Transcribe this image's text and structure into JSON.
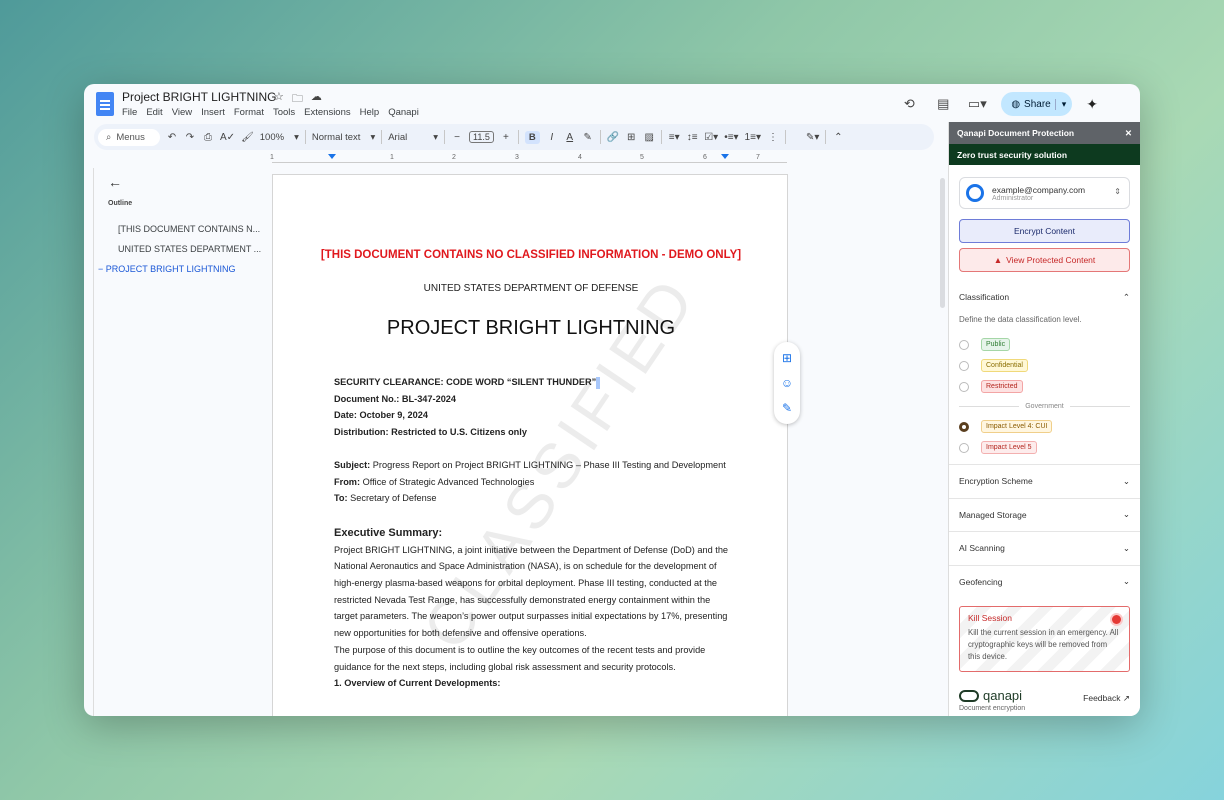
{
  "window": {
    "doc_title": "Project BRIGHT LIGHTNING",
    "menu": [
      "File",
      "Edit",
      "View",
      "Insert",
      "Format",
      "Tools",
      "Extensions",
      "Help",
      "Qanapi"
    ],
    "share_label": "Share"
  },
  "toolbar": {
    "menus_label": "Menus",
    "zoom": "100%",
    "style": "Normal text",
    "font": "Arial",
    "font_size": "11.5",
    "bold": "B",
    "italic": "I",
    "underline": "A"
  },
  "ruler": {
    "ticks": [
      "1",
      "1",
      "2",
      "3",
      "4",
      "5",
      "6",
      "7"
    ]
  },
  "outline": {
    "label": "Outline",
    "items": [
      "[THIS DOCUMENT CONTAINS N...",
      "UNITED STATES DEPARTMENT ...",
      "PROJECT BRIGHT LIGHTNING"
    ]
  },
  "document": {
    "banner": "[THIS DOCUMENT CONTAINS NO CLASSIFIED INFORMATION - DEMO ONLY]",
    "department": "UNITED STATES DEPARTMENT OF DEFENSE",
    "title": "PROJECT BRIGHT LIGHTNING",
    "watermark": "CLASSIFIED",
    "clearance": "SECURITY CLEARANCE: CODE WORD “SILENT THUNDER”",
    "doc_no": "Document No.: BL-347-2024",
    "date": "Date: October 9, 2024",
    "distribution": "Distribution: Restricted to U.S. Citizens only",
    "subject_label": "Subject:",
    "subject_text": " Progress Report on Project BRIGHT LIGHTNING – Phase III Testing and Development",
    "from_label": "From:",
    "from_text": " Office of Strategic Advanced Technologies",
    "to_label": "To:",
    "to_text": " Secretary of Defense",
    "exec_heading": "Executive Summary:",
    "exec_p1": "Project BRIGHT LIGHTNING, a joint initiative between the Department of Defense (DoD) and the National Aeronautics and Space Administration (NASA), is on schedule for the development of high-energy plasma-based weapons for orbital deployment. Phase III testing, conducted at the restricted Nevada Test Range, has successfully demonstrated energy containment within the target parameters. The weapon’s power output surpasses initial expectations by 17%, presenting new opportunities for both defensive and offensive operations.",
    "exec_p2": "The purpose of this document is to outline the key outcomes of the recent tests and provide guidance for the next steps, including global risk assessment and security protocols.",
    "section1": "1. Overview of Current Developments:"
  },
  "panel": {
    "header": "Qanapi Document Protection",
    "subheader": "Zero trust security solution",
    "account_email": "example@company.com",
    "account_role": "Administrator",
    "encrypt_label": "Encrypt Content",
    "view_label": "View Protected Content",
    "classification_title": "Classification",
    "classification_desc": "Define the data classification level.",
    "levels": [
      {
        "label": "Public",
        "bg": "#e6f4ea",
        "fg": "#2e7d32",
        "border": "#a5d6a7"
      },
      {
        "label": "Confidential",
        "bg": "#fff8d6",
        "fg": "#8a6d00",
        "border": "#f0d97a"
      },
      {
        "label": "Restricted",
        "bg": "#fde2e2",
        "fg": "#b3261e",
        "border": "#f3a5a5"
      }
    ],
    "government_label": "Government",
    "gov_levels": [
      {
        "label": "Impact Level 4: CUI",
        "bg": "#fff6e0",
        "fg": "#8a5a00",
        "border": "#f0cf8a",
        "selected": true
      },
      {
        "label": "Impact Level 5",
        "bg": "#fdecec",
        "fg": "#b3261e",
        "border": "#f3b0b0",
        "selected": false
      }
    ],
    "sections": [
      "Encryption Scheme",
      "Managed Storage",
      "AI Scanning",
      "Geofencing"
    ],
    "kill_title": "Kill Session",
    "kill_desc": "Kill the current session in an emergency. All cryptographic keys will be removed from this device.",
    "brand_name": "qanapi",
    "brand_sub": "Document encryption",
    "feedback": "Feedback"
  }
}
